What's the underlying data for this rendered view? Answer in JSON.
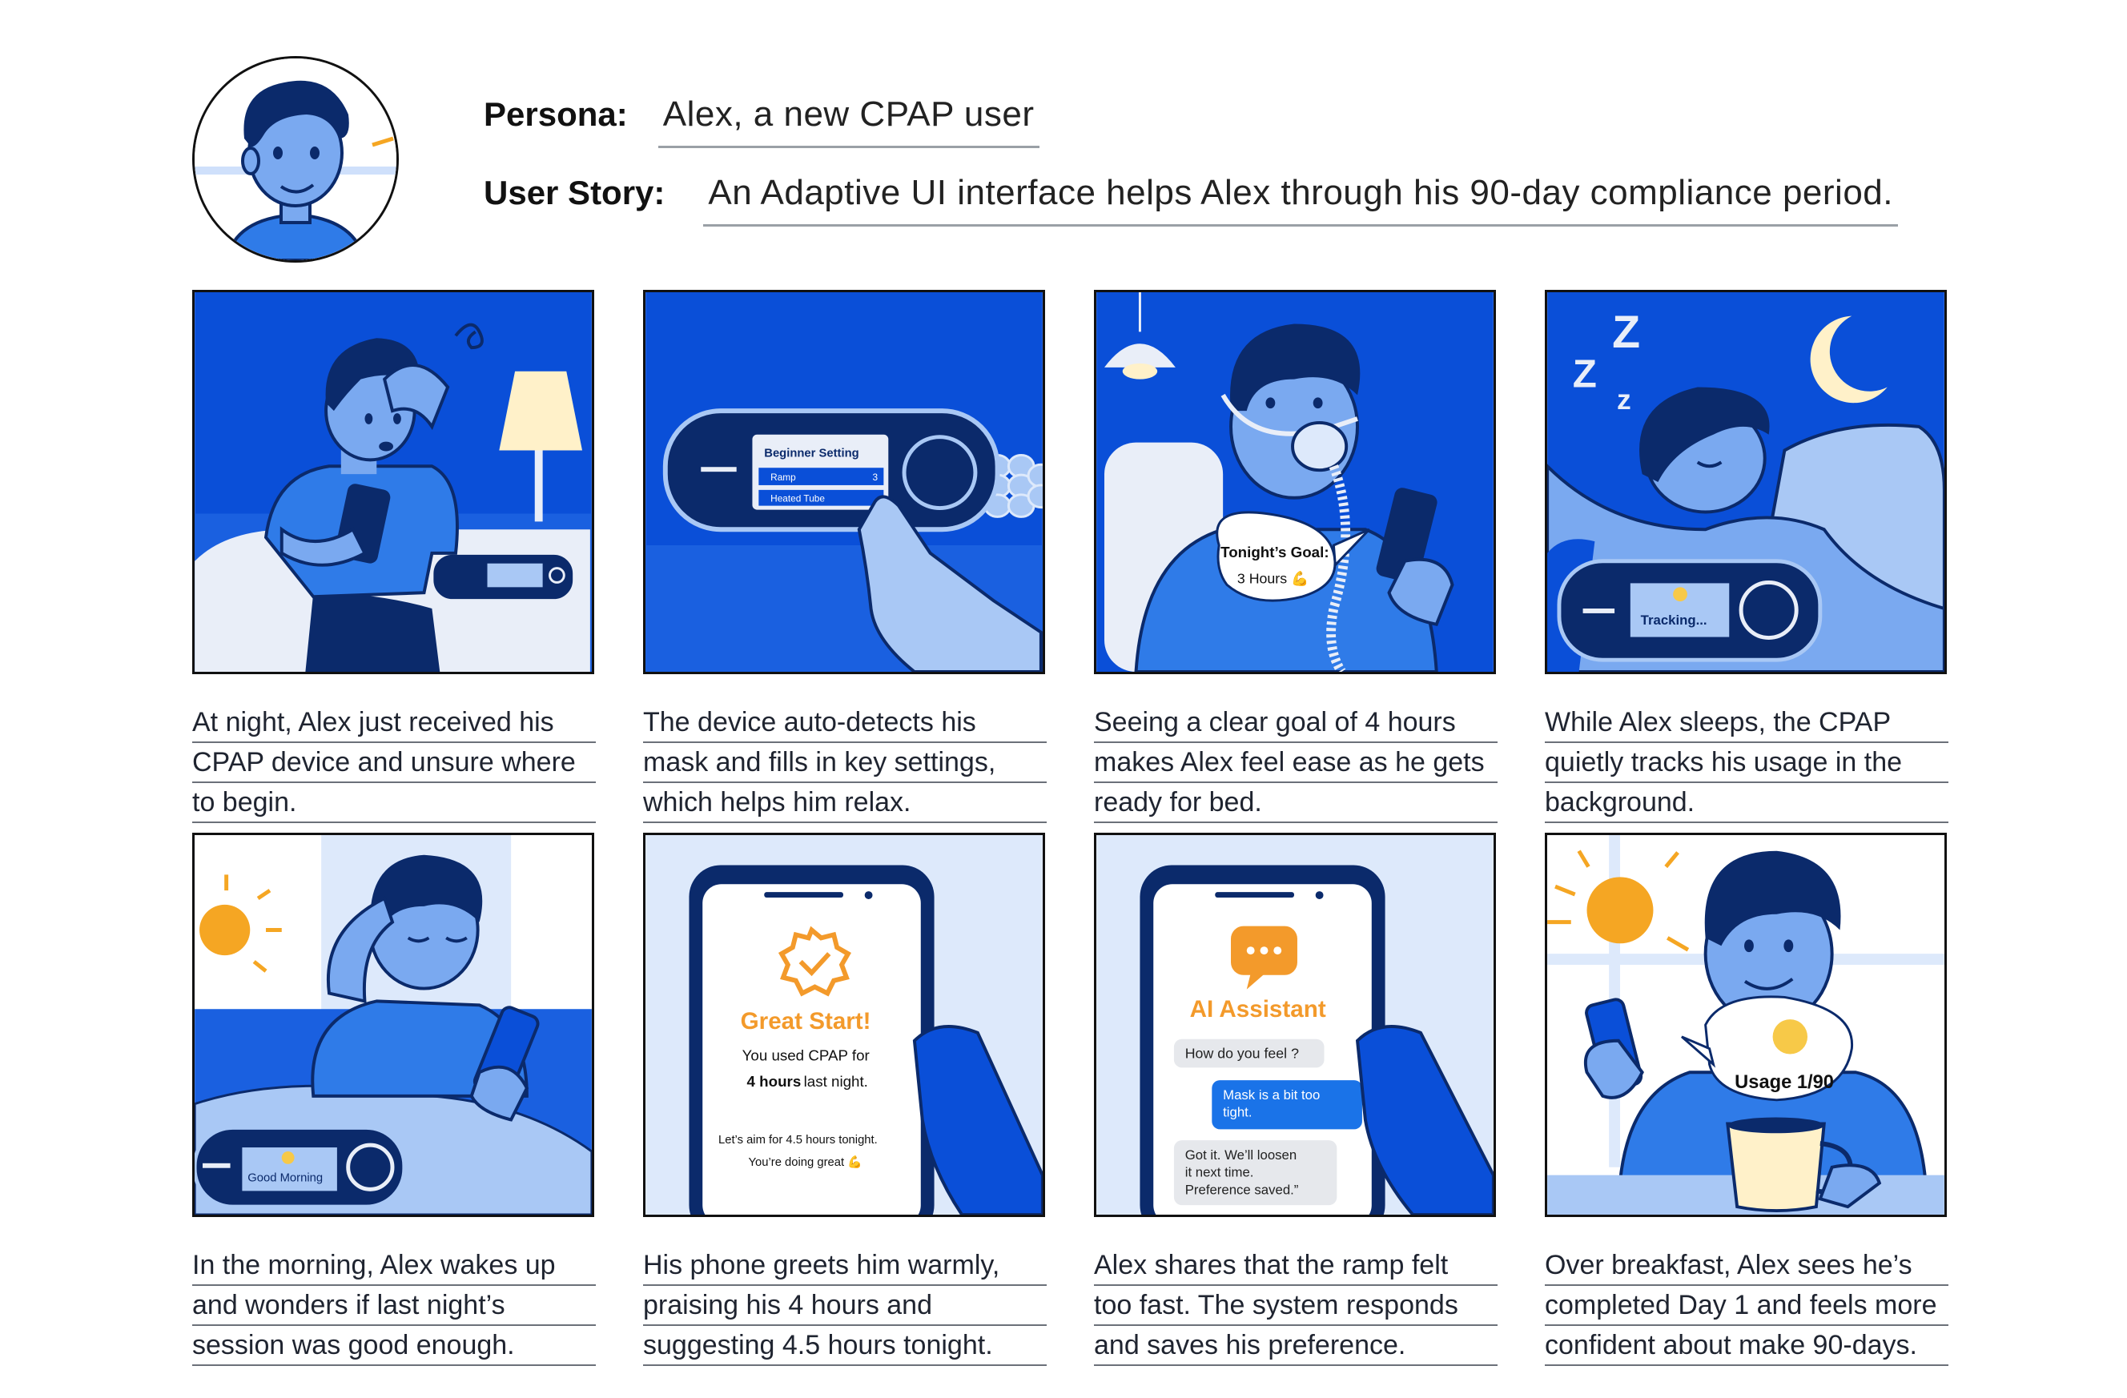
{
  "header": {
    "persona_label": "Persona:",
    "persona_value": "Alex, a new CPAP user",
    "story_label": "User Story:",
    "story_value": "An Adaptive UI interface helps Alex through his 90-day compliance period."
  },
  "colors": {
    "deep_blue": "#0a4fd8",
    "mid_blue": "#2f7be8",
    "light_blue": "#a9c8f5",
    "pale_blue": "#dde9fb",
    "navy": "#0b2a6b",
    "orange": "#f39a2b"
  },
  "panels": [
    {
      "icons": [
        "worried-man",
        "phone",
        "lamp",
        "cpap-device"
      ],
      "caption": [
        "At night, Alex just received his",
        "CPAP device and unsure where",
        "to begin."
      ]
    },
    {
      "screen_title": "Beginner Setting",
      "screen_rows": [
        {
          "label": "Ramp",
          "value": "3"
        },
        {
          "label": "Heated Tube",
          "value": ""
        }
      ],
      "icons": [
        "cpap-device",
        "pointing-hand",
        "hose"
      ],
      "caption": [
        "The device auto-detects his",
        "mask and fills in key settings,",
        "which helps him relax."
      ]
    },
    {
      "bubble_title": "Tonight’s Goal:",
      "bubble_text": "3 Hours 💪",
      "icons": [
        "mask-man",
        "pendant-lamp",
        "phone"
      ],
      "caption": [
        "Seeing a clear goal of 4 hours",
        "makes Alex feel ease as he gets",
        "ready for bed."
      ]
    },
    {
      "zzz": [
        "Z",
        "Z",
        "z"
      ],
      "screen_text": "Tracking...",
      "icons": [
        "sleeping-man",
        "moon-icon",
        "cpap-device",
        "smile-icon"
      ],
      "caption": [
        "While Alex sleeps, the CPAP",
        "quietly tracks his usage in the",
        "background."
      ]
    },
    {
      "screen_text": "Good Morning",
      "icons": [
        "waking-man",
        "sun-icon",
        "cpap-device",
        "phone"
      ],
      "caption": [
        "In the morning, Alex wakes up",
        "and wonders if last night’s",
        "session was good enough."
      ]
    },
    {
      "title": "Great Start!",
      "line1_a": "You used CPAP for",
      "line1_b_bold": "4 hours",
      "line1_c": "last night.",
      "line2": "Let’s aim for 4.5 hours tonight.",
      "line3": "You’re doing great 💪",
      "icons": [
        "badge-check-icon",
        "phone",
        "hand"
      ],
      "caption": [
        "His phone greets him warmly,",
        "praising his 4 hours and",
        "suggesting 4.5 hours tonight."
      ]
    },
    {
      "title": "AI Assistant",
      "chat": [
        {
          "from": "bot",
          "text": [
            "How do you feel ?"
          ]
        },
        {
          "from": "user",
          "text": [
            "Mask is a bit too",
            "tight."
          ]
        },
        {
          "from": "bot",
          "text": [
            "Got it. We’ll loosen",
            "it next time.",
            "Preference saved.”"
          ]
        }
      ],
      "icons": [
        "chat-bubble-icon",
        "phone",
        "hand"
      ],
      "caption": [
        "Alex shares that the ramp felt",
        "too fast. The system responds",
        "and saves his preference."
      ]
    },
    {
      "bubble_text": "Usage 1/90",
      "icons": [
        "smiling-man",
        "sun-icon",
        "smile-icon",
        "mug",
        "phone"
      ],
      "caption": [
        " Over breakfast, Alex sees he’s",
        "completed Day 1 and feels more",
        "confident about make 90-days."
      ]
    }
  ]
}
